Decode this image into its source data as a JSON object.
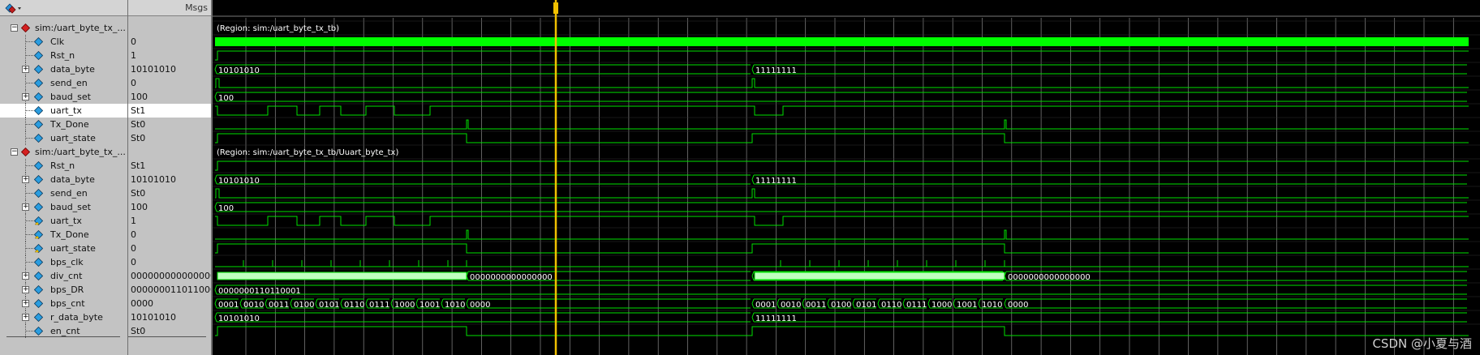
{
  "header": {
    "msgs_title": "Msgs",
    "toolbar_icon": "wave-format-icon"
  },
  "groups": [
    {
      "name": "sim:/uart_byte_tx_...",
      "region": "(Region: sim:/uart_byte_tx_tb)"
    },
    {
      "name": "sim:/uart_byte_tx_...",
      "region": "(Region: sim:/uart_byte_tx_tb/Uuart_byte_tx)"
    }
  ],
  "signals": [
    {
      "name": "Clk",
      "value": "0",
      "bus": false
    },
    {
      "name": "Rst_n",
      "value": "1",
      "bus": false
    },
    {
      "name": "data_byte",
      "value": "10101010",
      "bus": true
    },
    {
      "name": "send_en",
      "value": "0",
      "bus": false
    },
    {
      "name": "baud_set",
      "value": "100",
      "bus": true
    },
    {
      "name": "uart_tx",
      "value": "St1",
      "bus": false
    },
    {
      "name": "Tx_Done",
      "value": "St0",
      "bus": false
    },
    {
      "name": "uart_state",
      "value": "St0",
      "bus": false
    },
    {
      "name": "Rst_n",
      "value": "St1",
      "bus": false
    },
    {
      "name": "data_byte",
      "value": "10101010",
      "bus": true
    },
    {
      "name": "send_en",
      "value": "St0",
      "bus": false
    },
    {
      "name": "baud_set",
      "value": "100",
      "bus": true
    },
    {
      "name": "uart_tx",
      "value": "1",
      "bus": false
    },
    {
      "name": "Tx_Done",
      "value": "0",
      "bus": false
    },
    {
      "name": "uart_state",
      "value": "0",
      "bus": false
    },
    {
      "name": "bps_clk",
      "value": "0",
      "bus": false
    },
    {
      "name": "div_cnt",
      "value": "0000000000000000",
      "bus": true
    },
    {
      "name": "bps_DR",
      "value": "0000000110110001",
      "bus": true
    },
    {
      "name": "bps_cnt",
      "value": "0000",
      "bus": true
    },
    {
      "name": "r_data_byte",
      "value": "10101010",
      "bus": true
    },
    {
      "name": "en_cnt",
      "value": "St0",
      "bus": false
    }
  ],
  "wave_labels": {
    "data_byte_a": "10101010",
    "data_byte_b": "11111111",
    "baud_set": "100",
    "div_cnt_zero": "0000000000000000",
    "bps_DR": "0000000110110001",
    "bps_cnt_seq": [
      "0001",
      "0010",
      "0011",
      "0100",
      "0101",
      "0110",
      "0111",
      "1000",
      "1001",
      "1010",
      "0000"
    ]
  },
  "colors": {
    "wave": "#00e000",
    "clock_fill": "#00ff00",
    "cursor": "#f0c000",
    "grid": "#8a8a8a",
    "bus_fill": "#bfffbf",
    "value_text": "#ffffff",
    "region_text": "#ffffff"
  },
  "watermark": "CSDN @小夏与酒"
}
